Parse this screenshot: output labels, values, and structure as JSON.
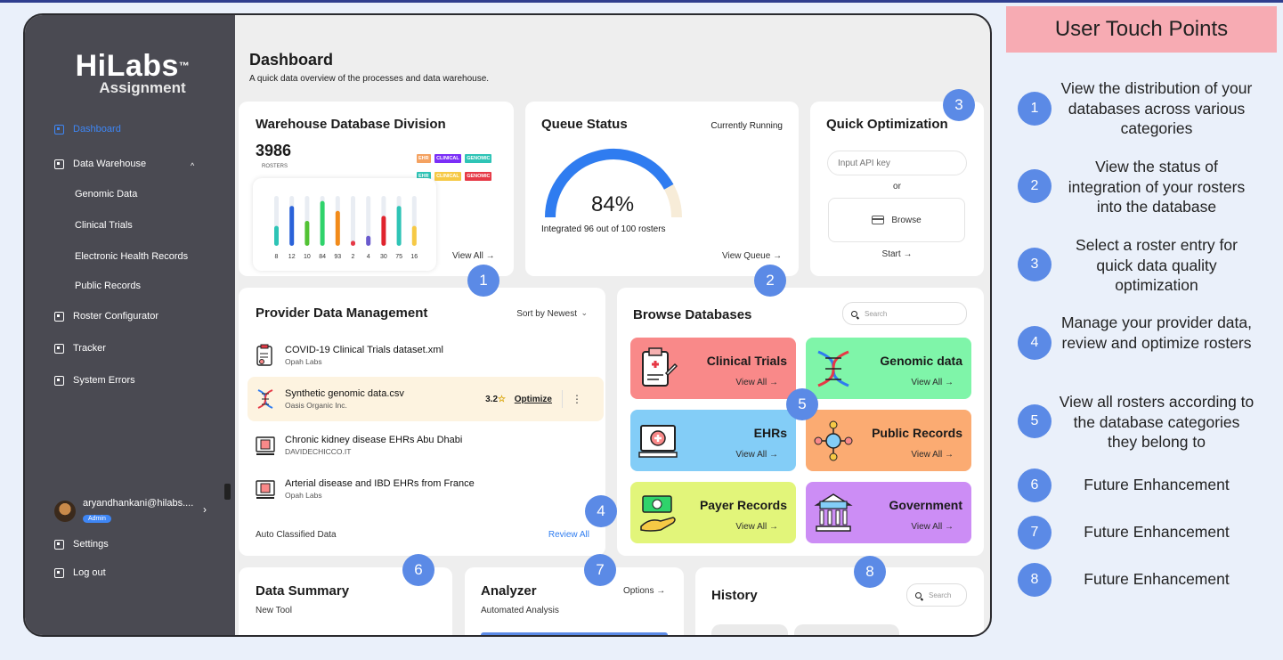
{
  "panel": {
    "title": "User Touch Points",
    "points": [
      {
        "num": "1",
        "text": "View the distribution of your databases across various categories"
      },
      {
        "num": "2",
        "text": "View the status of integration of your rosters into the database"
      },
      {
        "num": "3",
        "text": "Select a roster entry for quick data quality optimization"
      },
      {
        "num": "4",
        "text": "Manage your provider data, review and optimize rosters"
      },
      {
        "num": "5",
        "text": "View all rosters according to the database categories they belong to"
      },
      {
        "num": "6",
        "text": "Future Enhancement"
      },
      {
        "num": "7",
        "text": "Future Enhancement"
      },
      {
        "num": "8",
        "text": "Future Enhancement"
      }
    ]
  },
  "sidebar": {
    "brand": "HiLabs",
    "tm": "™",
    "brand_sub": "Assignment",
    "nav": {
      "dashboard": "Dashboard",
      "data_warehouse": "Data Warehouse",
      "roster_configurator": "Roster Configurator",
      "tracker": "Tracker",
      "system_errors": "System Errors",
      "settings": "Settings",
      "logout": "Log out"
    },
    "sub_items": [
      "Genomic Data",
      "Clinical Trials",
      "Electronic Health Records",
      "Public Records"
    ],
    "user": {
      "email": "aryandhankani@hilabs....",
      "role": "Admin"
    }
  },
  "header": {
    "title": "Dashboard",
    "subtitle": "A quick data overview of the processes and data warehouse."
  },
  "warehouse": {
    "title": "Warehouse Database Division",
    "count": "3986",
    "count_label": "ROSTERS",
    "tags_row1": [
      "EHR",
      "CLINICAL",
      "GENOMIC"
    ],
    "tags_row2": [
      "EHR",
      "CLINICAL",
      "GENOMIC"
    ],
    "view_all": "View All →",
    "colors": {
      "ehr": "#f4a261",
      "clinical": "#7b2ff7",
      "genomic": "#2ec4b6",
      "ehr2": "#2ec4b6",
      "clinical2": "#f6c945",
      "genomic2": "#e63946"
    }
  },
  "chart_data": {
    "type": "bar",
    "categories": [
      "8",
      "12",
      "10",
      "84",
      "93",
      "2",
      "4",
      "30",
      "75",
      "16"
    ],
    "values": [
      8,
      12,
      10,
      84,
      93,
      2,
      4,
      30,
      75,
      16
    ],
    "fills": [
      0.4,
      0.8,
      0.5,
      0.9,
      0.7,
      0.1,
      0.2,
      0.6,
      0.8,
      0.4
    ],
    "colors": [
      "#2ec4b6",
      "#2a62d9",
      "#52c234",
      "#2fd36b",
      "#f28b1a",
      "#e63946",
      "#6a5acd",
      "#e0242e",
      "#2ec4b6",
      "#f6c945"
    ],
    "title": "",
    "xlabel": "",
    "ylabel": ""
  },
  "queue": {
    "title": "Queue Status",
    "state": "Currently Running",
    "percent": "84%",
    "percent_value": 84,
    "integrated": "Integrated 96 out of 100 rosters",
    "view_queue": "View Queue →"
  },
  "quick": {
    "title": "Quick Optimization",
    "api_placeholder": "Input API key",
    "or": "or",
    "browse": "Browse",
    "start": "Start →"
  },
  "provider": {
    "title": "Provider Data Management",
    "sort": "Sort by Newest",
    "rows": [
      {
        "name": "COVID-19 Clinical Trials dataset.xml",
        "org": "Opah Labs"
      },
      {
        "name": "Synthetic genomic data.csv",
        "org": "Oasis Organic Inc.",
        "rating": "3.2",
        "action": "Optimize"
      },
      {
        "name": "Chronic kidney disease EHRs Abu Dhabi",
        "org": "DAVIDECHICCO.IT"
      },
      {
        "name": "Arterial disease and IBD EHRs from France",
        "org": "Opah Labs"
      }
    ],
    "footer": "Auto Classified Data",
    "review": "Review All"
  },
  "browse": {
    "title": "Browse Databases",
    "search_placeholder": "Search",
    "tiles": [
      {
        "title": "Clinical Trials",
        "link": "View All →",
        "color": "#f98989"
      },
      {
        "title": "Genomic data",
        "link": "View All →",
        "color": "#7ff5a9"
      },
      {
        "title": "EHRs",
        "link": "View All →",
        "color": "#83cdf7"
      },
      {
        "title": "Public Records",
        "link": "View All →",
        "color": "#fbab72"
      },
      {
        "title": "Payer Records",
        "link": "View All →",
        "color": "#e2f57a"
      },
      {
        "title": "Government",
        "link": "View All →",
        "color": "#cc8df5"
      }
    ]
  },
  "summary": {
    "title": "Data Summary",
    "subtitle": "New Tool"
  },
  "analyzer": {
    "title": "Analyzer",
    "subtitle": "Automated Analysis",
    "options": "Options →"
  },
  "history": {
    "title": "History",
    "search_placeholder": "Search"
  },
  "markers": [
    "1",
    "2",
    "3",
    "4",
    "5",
    "6",
    "7",
    "8"
  ]
}
